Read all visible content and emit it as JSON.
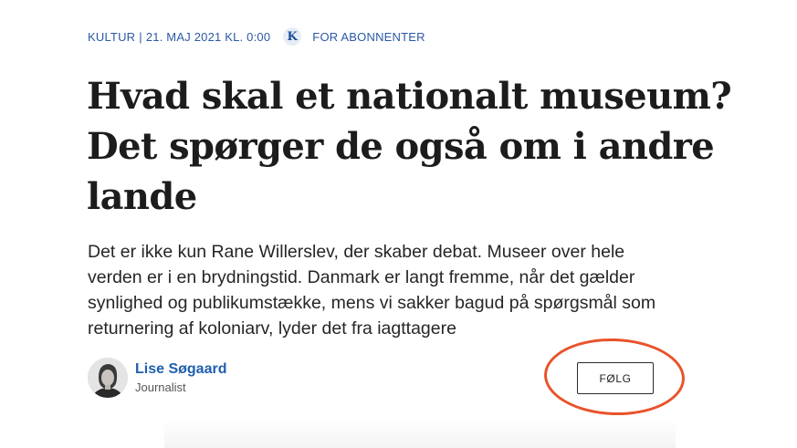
{
  "article": {
    "section": "KULTUR",
    "separator": "|",
    "dateline": "21. MAJ 2021 KL. 0:00",
    "subscriber_badge": "K",
    "subscriber_label": "FOR ABONNENTER",
    "headline": "Hvad skal et nationalt museum? Det spørger de også om i andre lande",
    "lead": "Det er ikke kun Rane Willerslev, der skaber debat. Museer over hele verden er i en brydningstid. Danmark er langt fremme, når det gælder synlighed og publikumstække, mens vi sakker bagud på spørgsmål som returnering af koloniarv, lyder det fra iagttagere"
  },
  "author": {
    "name": "Lise Søgaard",
    "role": "Journalist",
    "follow_label": "FØLG"
  },
  "icons": {
    "subscriber": "k-logo-icon",
    "avatar": "author-portrait"
  },
  "colors": {
    "accent_blue": "#2b5aa6",
    "author_link": "#1f5fae",
    "annotation_ring": "#e8532a"
  }
}
